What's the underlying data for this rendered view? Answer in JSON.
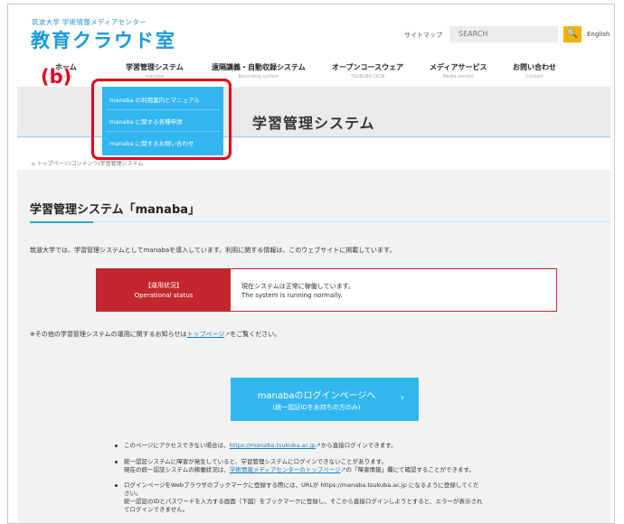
{
  "header": {
    "org": "筑波大学 学術情報メディアセンター",
    "logo": "教育クラウド室",
    "sitemap": "サイトマップ",
    "search_placeholder": "SEARCH",
    "search_icon_glyph": "🔍",
    "english": "English"
  },
  "nav": [
    {
      "ja": "ホーム",
      "en": "Home"
    },
    {
      "ja": "学習管理システム",
      "en": "manaba"
    },
    {
      "ja": "遠隔講義・自動収録システム",
      "en": "Recording system"
    },
    {
      "ja": "オープンコースウェア",
      "en": "TSUKUBA OCW"
    },
    {
      "ja": "メディアサービス",
      "en": "Media service"
    },
    {
      "ja": "お問い合わせ",
      "en": "Contact"
    }
  ],
  "dropdown": [
    "manaba の利用案内とマニュアル",
    "manaba に関する各種申請",
    "manaba に関するお問い合わせ"
  ],
  "annotation_label": "(b)",
  "banner_title": "学習管理システム",
  "breadcrumb": "トップページ/コンテンツ/学習管理システム",
  "page_heading": "学習管理システム「manaba」",
  "intro": "筑波大学では、学習管理システムとしてmanabaを導入しています。利用に関する情報は、このウェブサイトに掲載しています。",
  "status": {
    "label_ja": "【運用状況】",
    "label_en": "Operational status",
    "text_ja": "現在システムは正常に稼働しています。",
    "text_en": "The system is running normally."
  },
  "notice": {
    "before": "※その他の学習管理システムの運用に関するお知らせは",
    "link": "トップページ",
    "after": "をご覧ください。"
  },
  "login_button": {
    "line1": "manabaのログインページへ",
    "line2": "(統一認証IDをお持ちの方のみ)",
    "arrow": "›"
  },
  "bullets": {
    "b1_before": "このページにアクセスできない場合は、",
    "b1_link": "https://manaba.tsukuba.ac.jp",
    "b1_after": "から直接ログインできます。",
    "b2_l1": "統一認証システムに障害が発生していると、学習管理システムにログインできないことがあります。",
    "b2_l2_before": "現在の統一認証システムの稼働状況は、",
    "b2_l2_link": "学術情報メディアセンターのトップページ",
    "b2_l2_after": "の「障害情報」欄にて確認することができます。",
    "b3_l1": "ログインページをWebブラウザのブックマークに登録する際には、URLが https://manaba.tsukuba.ac.jp になるように登録してくだ",
    "b3_l2": "さい。",
    "b3_l3": "統一認証のIDとパスワードを入力する画面（下図）をブックマークに登録し、そこから直接ログインしようとすると、エラーが表示され",
    "b3_l4": "てログインできません。"
  },
  "colors": {
    "accent": "#32b6ef",
    "logo": "#1a9ad6",
    "status_red": "#c1272d",
    "annotation_red": "#e3001b",
    "search_button": "#f0b400"
  }
}
